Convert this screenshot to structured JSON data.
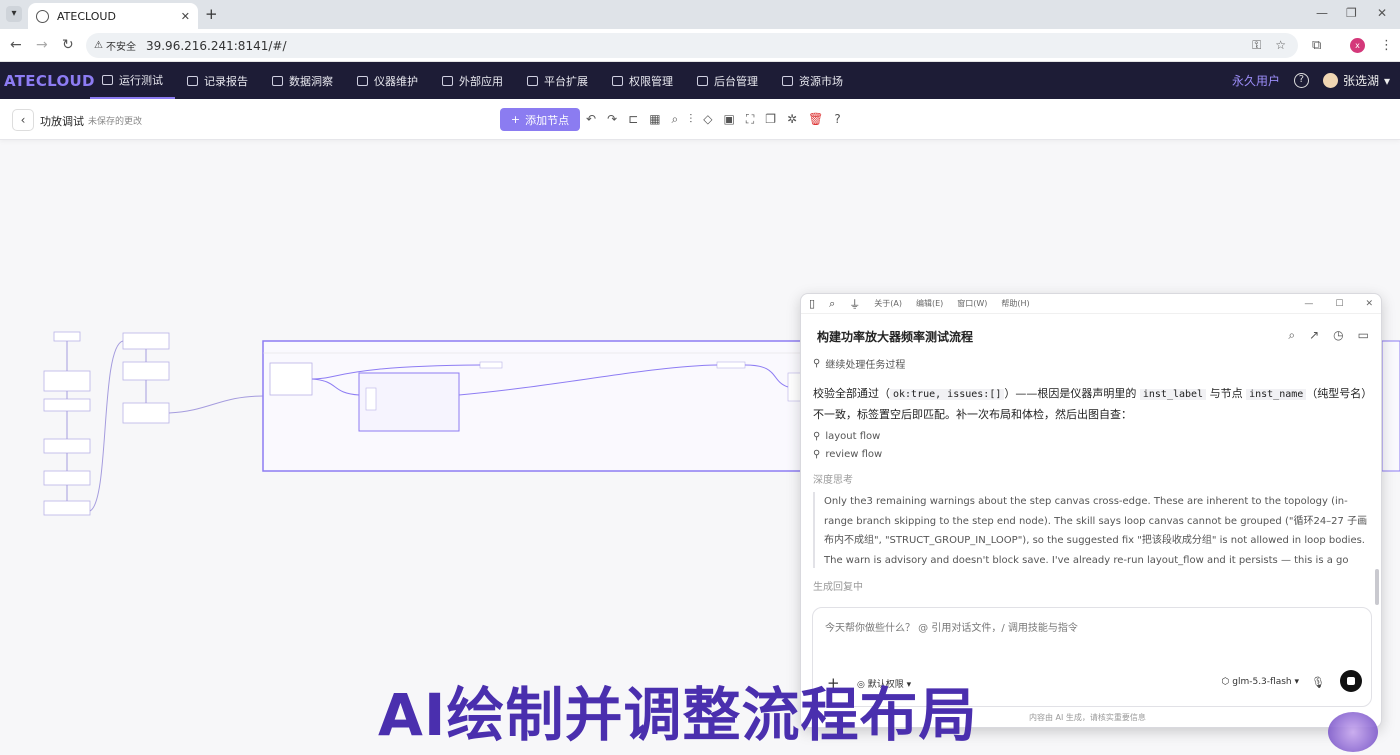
{
  "browser": {
    "tab_title": "ATECLOUD",
    "security_label": "不安全",
    "url": "39.96.216.241:8141/#/",
    "profile_initial": "x"
  },
  "nav": {
    "brand": "ATECLOUD",
    "items": [
      {
        "label": "运行测试",
        "active": true
      },
      {
        "label": "记录报告"
      },
      {
        "label": "数据洞察"
      },
      {
        "label": "仪器维护"
      },
      {
        "label": "外部应用"
      },
      {
        "label": "平台扩展"
      },
      {
        "label": "权限管理"
      },
      {
        "label": "后台管理"
      },
      {
        "label": "资源市场"
      }
    ],
    "vip_label": "永久用户",
    "user_name": "张选湖"
  },
  "toolbar": {
    "page_name": "功放调试",
    "unsaved": "未保存的更改",
    "add_node": "添加节点"
  },
  "chat": {
    "menu": [
      "关于(A)",
      "编辑(E)",
      "窗口(W)",
      "帮助(H)"
    ],
    "title": "构建功率放大器频率测试流程",
    "step_continue": "继续处理任务过程",
    "msg_part1": "校验全部通过（",
    "msg_code1": "ok:true, issues:[]",
    "msg_part2": "）——根因是仪器声明里的 ",
    "msg_code2": "inst_label",
    "msg_part3": " 与节点 ",
    "msg_code3": "inst_name",
    "msg_part4": "（纯型号名）不一致，标签置空后即匹配。补一次布局和体检，然后出图自查：",
    "step_layout": "layout flow",
    "step_review": "review flow",
    "think_label": "深度思考",
    "think_text": "Only the3 remaining warnings about the step canvas cross-edge. These are inherent to the topology (in-range branch skipping to the step end node). The skill says loop canvas cannot be grouped (\"循环24–27 子画布内不成组\", \"STRUCT_GROUP_IN_LOOP\"), so the suggested fix \"把该段收成分组\" is not allowed in loop bodies. The warn is advisory and doesn't block save. I've already re-run layout_flow and it persists — this is a go",
    "generating": "生成回复中",
    "input_placeholder": "今天帮你做些什么？ @ 引用对话文件，/ 调用技能与指令",
    "permission": "默认权限",
    "model": "glm-5.3-flash",
    "disclaimer": "内容由 AI 生成，请核实重要信息"
  },
  "caption": "AI绘制并调整流程布局"
}
